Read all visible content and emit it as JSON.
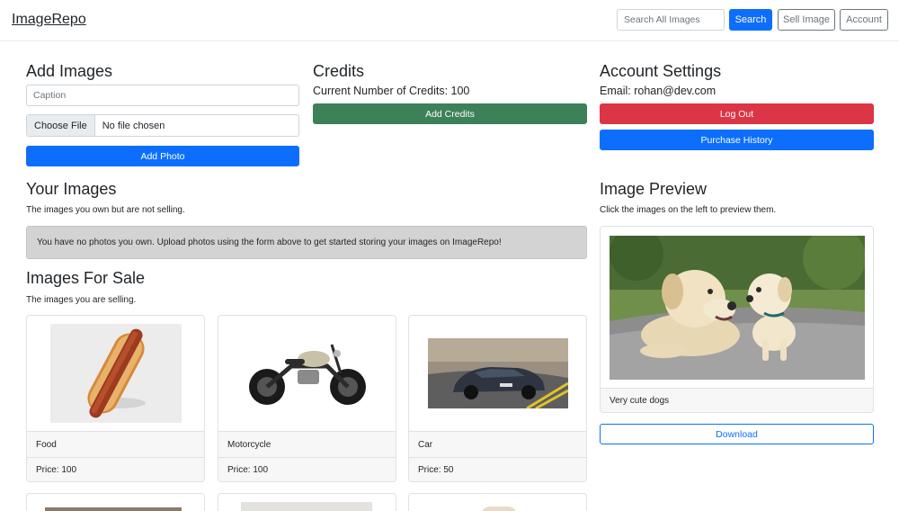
{
  "nav": {
    "brand": "ImageRepo",
    "search_placeholder": "Search All Images",
    "search_label": "Search",
    "sell_label": "Sell Image",
    "account_label": "Account"
  },
  "add_images": {
    "title": "Add Images",
    "caption_placeholder": "Caption",
    "choose_file_label": "Choose File",
    "file_status": "No file chosen",
    "add_photo_label": "Add Photo"
  },
  "credits": {
    "title": "Credits",
    "current_text": "Current Number of Credits: 100",
    "add_credits_label": "Add Credits"
  },
  "account_settings": {
    "title": "Account Settings",
    "email_text": "Email: rohan@dev.com",
    "logout_label": "Log Out",
    "purchase_history_label": "Purchase History"
  },
  "your_images": {
    "title": "Your Images",
    "subtitle": "The images you own but are not selling.",
    "empty_message": "You have no photos you own. Upload photos using the form above to get started storing your images on ImageRepo!"
  },
  "for_sale": {
    "title": "Images For Sale",
    "subtitle": "The images you are selling.",
    "items": [
      {
        "name": "Food",
        "price": "Price: 100"
      },
      {
        "name": "Motorcycle",
        "price": "Price: 100"
      },
      {
        "name": "Car",
        "price": "Price: 50"
      }
    ]
  },
  "preview": {
    "title": "Image Preview",
    "subtitle": "Click the images on the left to preview them.",
    "caption": "Very cute dogs",
    "download_label": "Download"
  },
  "colors": {
    "primary": "#0d6efd",
    "success": "#3c8157",
    "danger": "#dc3545",
    "alert_bg": "#d3d3d3"
  }
}
